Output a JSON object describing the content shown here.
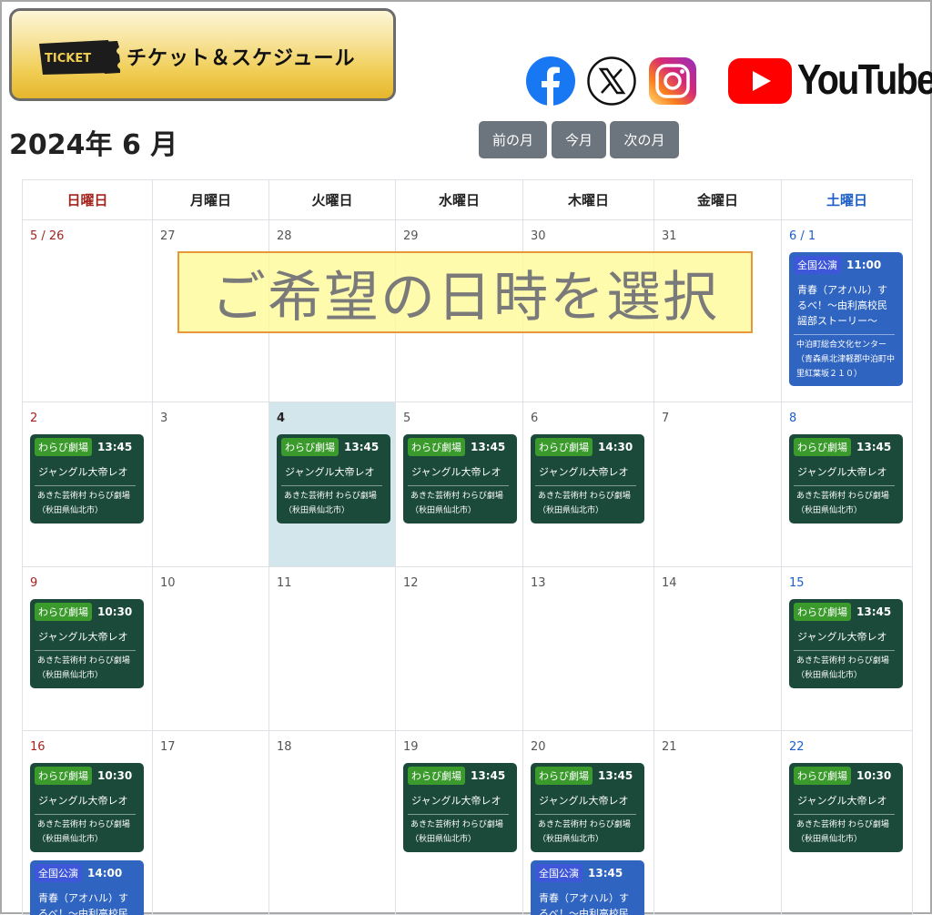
{
  "header": {
    "ticket_logo_text": "TICKET",
    "ticket_label": "チケット＆スケジュール",
    "social": [
      "facebook-icon",
      "x-icon",
      "instagram-icon",
      "youtube-icon"
    ],
    "youtube_word": "YouTube"
  },
  "month_title": "2024年 6 月",
  "nav": {
    "prev": "前の月",
    "today": "今月",
    "next": "次の月"
  },
  "weekdays": [
    "日曜日",
    "月曜日",
    "火曜日",
    "水曜日",
    "木曜日",
    "金曜日",
    "土曜日"
  ],
  "overlay_text": "ご希望の日時を選択",
  "weeks": [
    {
      "days": [
        {
          "label": "5 / 26",
          "events": []
        },
        {
          "label": "27",
          "events": []
        },
        {
          "label": "28",
          "events": []
        },
        {
          "label": "29",
          "events": []
        },
        {
          "label": "30",
          "events": []
        },
        {
          "label": "31",
          "events": []
        },
        {
          "label": "6 / 1",
          "events": [
            {
              "kind": "blue",
              "badge": "全国公演",
              "time": "11:00",
              "title": "青春（アオハル）するべ！〜由利高校民謡部ストーリー〜",
              "venue": "中泊町総合文化センター（青森県北津軽郡中泊町中里紅葉坂２１０）"
            }
          ]
        }
      ]
    },
    {
      "days": [
        {
          "label": "2",
          "events": [
            {
              "kind": "green",
              "badge": "わらび劇場",
              "time": "13:45",
              "title": "ジャングル大帝レオ",
              "venue": "あきた芸術村 わらび劇場（秋田県仙北市）"
            }
          ]
        },
        {
          "label": "3",
          "events": []
        },
        {
          "label": "4",
          "today": true,
          "events": [
            {
              "kind": "green",
              "badge": "わらび劇場",
              "time": "13:45",
              "title": "ジャングル大帝レオ",
              "venue": "あきた芸術村 わらび劇場（秋田県仙北市）"
            }
          ]
        },
        {
          "label": "5",
          "events": [
            {
              "kind": "green",
              "badge": "わらび劇場",
              "time": "13:45",
              "title": "ジャングル大帝レオ",
              "venue": "あきた芸術村 わらび劇場（秋田県仙北市）"
            }
          ]
        },
        {
          "label": "6",
          "events": [
            {
              "kind": "green",
              "badge": "わらび劇場",
              "time": "14:30",
              "title": "ジャングル大帝レオ",
              "venue": "あきた芸術村 わらび劇場（秋田県仙北市）"
            }
          ]
        },
        {
          "label": "7",
          "events": []
        },
        {
          "label": "8",
          "events": [
            {
              "kind": "green",
              "badge": "わらび劇場",
              "time": "13:45",
              "title": "ジャングル大帝レオ",
              "venue": "あきた芸術村 わらび劇場（秋田県仙北市）"
            }
          ]
        }
      ]
    },
    {
      "days": [
        {
          "label": "9",
          "events": [
            {
              "kind": "green",
              "badge": "わらび劇場",
              "time": "10:30",
              "title": "ジャングル大帝レオ",
              "venue": "あきた芸術村 わらび劇場（秋田県仙北市）"
            }
          ]
        },
        {
          "label": "10",
          "events": []
        },
        {
          "label": "11",
          "events": []
        },
        {
          "label": "12",
          "events": []
        },
        {
          "label": "13",
          "events": []
        },
        {
          "label": "14",
          "events": []
        },
        {
          "label": "15",
          "events": [
            {
              "kind": "green",
              "badge": "わらび劇場",
              "time": "13:45",
              "title": "ジャングル大帝レオ",
              "venue": "あきた芸術村 わらび劇場（秋田県仙北市）"
            }
          ]
        }
      ]
    },
    {
      "days": [
        {
          "label": "16",
          "events": [
            {
              "kind": "green",
              "badge": "わらび劇場",
              "time": "10:30",
              "title": "ジャングル大帝レオ",
              "venue": "あきた芸術村 わらび劇場（秋田県仙北市）"
            },
            {
              "kind": "blue",
              "badge": "全国公演",
              "time": "14:00",
              "title": "青春（アオハル）するべ！〜由利高校民謡部ストーリー〜",
              "venue": ""
            }
          ]
        },
        {
          "label": "17",
          "events": []
        },
        {
          "label": "18",
          "events": []
        },
        {
          "label": "19",
          "events": [
            {
              "kind": "green",
              "badge": "わらび劇場",
              "time": "13:45",
              "title": "ジャングル大帝レオ",
              "venue": "あきた芸術村 わらび劇場（秋田県仙北市）"
            }
          ]
        },
        {
          "label": "20",
          "events": [
            {
              "kind": "green",
              "badge": "わらび劇場",
              "time": "13:45",
              "title": "ジャングル大帝レオ",
              "venue": "あきた芸術村 わらび劇場（秋田県仙北市）"
            },
            {
              "kind": "blue",
              "badge": "全国公演",
              "time": "13:45",
              "title": "青春（アオハル）するべ！〜由利高校民謡部ストーリー〜",
              "venue": ""
            }
          ]
        },
        {
          "label": "21",
          "events": []
        },
        {
          "label": "22",
          "events": [
            {
              "kind": "green",
              "badge": "わらび劇場",
              "time": "10:30",
              "title": "ジャングル大帝レオ",
              "venue": "あきた芸術村 わらび劇場（秋田県仙北市）"
            }
          ]
        }
      ]
    }
  ]
}
